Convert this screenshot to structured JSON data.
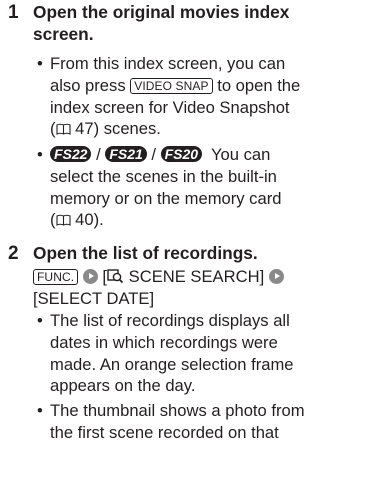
{
  "steps": [
    {
      "number": "1",
      "heading_line1": "Open the original movies index",
      "heading_line2": "screen.",
      "bullets": [
        {
          "l1": "From this index screen, you can",
          "l2a": "also press ",
          "key": "VIDEO SNAP",
          "l2b": " to open the",
          "l3": "index screen for Video Snapshot",
          "l4a": "(",
          "l4ref": " 47) scenes."
        },
        {
          "badge1": "FS22",
          "sep1": " / ",
          "badge2": "FS21",
          "sep2": " / ",
          "badge3": "FS20",
          "l1b": "  You can",
          "l2": "select the scenes in the built-in",
          "l3": "memory or on the memory card",
          "l4a": "(",
          "l4ref": " 40)."
        }
      ]
    },
    {
      "number": "2",
      "heading": "Open the list of recordings.",
      "func_key": "FUNC.",
      "menu_a_pre": " [",
      "menu_a": " SCENE SEARCH] ",
      "menu_b": "[SELECT DATE]",
      "bullets": [
        {
          "l1": "The list of recordings displays all",
          "l2": "dates in which recordings were",
          "l3": "made. An orange selection frame",
          "l4": "appears on the day."
        },
        {
          "l1": "The thumbnail shows a photo from",
          "l2": "the first scene recorded on that"
        }
      ]
    }
  ],
  "icons": {
    "book": "book-reference-icon",
    "arrow": "arrow-next-icon",
    "search": "scene-search-icon"
  }
}
